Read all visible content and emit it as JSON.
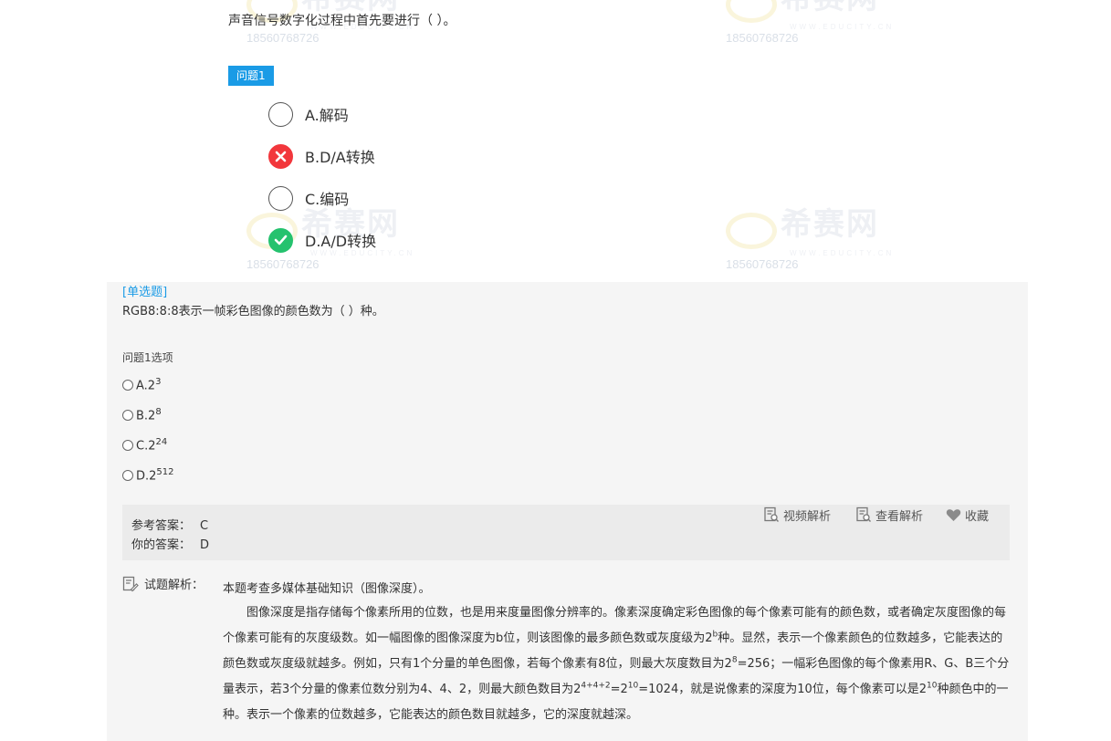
{
  "watermark": {
    "logo_text": "希赛网",
    "sub_text": "WWW.EDUCITY.CN",
    "phone": "18560768726"
  },
  "question1": {
    "text": "声音信号数字化过程中首先要进行（ ）。",
    "badge": "问题1",
    "options": [
      {
        "label": "A.解码",
        "state": "none"
      },
      {
        "label": "B.D/A转换",
        "state": "wrong"
      },
      {
        "label": "C.编码",
        "state": "none"
      },
      {
        "label": "D.A/D转换",
        "state": "correct"
      }
    ]
  },
  "question2": {
    "type": "[单选题]",
    "text": "RGB8:8:8表示一帧彩色图像的颜色数为（ ）种。",
    "sub_label": "问题1选项",
    "options": [
      {
        "base": "A.2",
        "exp": "3"
      },
      {
        "base": "B.2",
        "exp": "8"
      },
      {
        "base": "C.2",
        "exp": "24"
      },
      {
        "base": "D.2",
        "exp": "512"
      }
    ],
    "reference_label": "参考答案：",
    "reference_value": "C",
    "your_label": "你的答案：",
    "your_value": "D",
    "actions": {
      "video": "视频解析",
      "view": "查看解析",
      "favorite": "收藏"
    },
    "explanation_label": "试题解析：",
    "explanation_first": "本题考查多媒体基础知识（图像深度）。",
    "explanation": {
      "p1": "图像深度是指存储每个像素所用的位数，也是用来度量图像分辨率的。像素深度确定彩色图像的每个像素可能有的颜色数，或者确定灰度图像的每个像素可能有的灰度级数。如一幅图像的图像深度为b位，则该图像的最多颜色数或灰度级为2",
      "s1": "b",
      "p2": "种。显然，表示一个像素颜色的位数越多，它能表达的颜色数或灰度级就越多。例如，只有1个分量的单色图像，若每个像素有8位，则最大灰度数目为2",
      "s2": "8",
      "p3": "=256；一幅彩色图像的每个像素用R、G、B三个分量表示，若3个分量的像素位数分别为4、4、2，则最大颜色数目为2",
      "s3": "4+4+2",
      "p4": "=2",
      "s4": "10",
      "p5": "=1024，就是说像素的深度为10位，每个像素可以是2",
      "s5": "10",
      "p6": "种颜色中的一种。表示一个像素的位数越多，它能表达的颜色数目就越多，它的深度就越深。"
    }
  }
}
